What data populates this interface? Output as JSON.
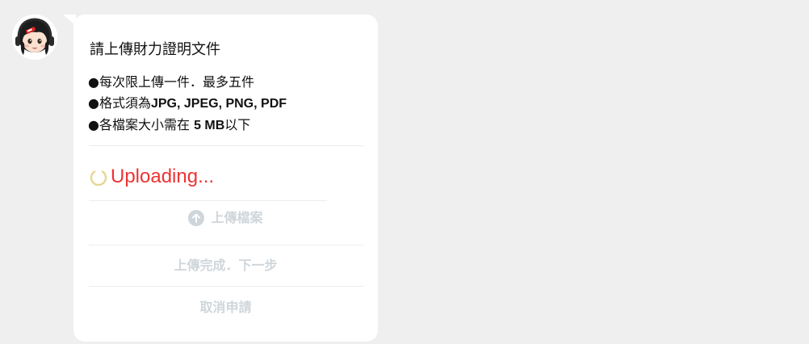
{
  "avatar": {
    "icon": "girl-avatar-icon"
  },
  "message": {
    "title": "請上傳財力證明文件",
    "rules": [
      {
        "text": "●每次限上傳一件．最多五件"
      },
      {
        "prefix": "●格式須為",
        "bold": "JPG, JPEG, PNG, PDF"
      },
      {
        "prefix": "●各檔案大小需在 ",
        "bold": "5 MB",
        "suffix": "以下"
      }
    ],
    "uploading_text": "Uploading...",
    "spinner_icon": "loading-spinner-icon",
    "upload_button_label": "上傳檔案",
    "upload_button_icon": "arrow-up-circle-icon",
    "complete_button_label": "上傳完成．下一步",
    "cancel_button_label": "取消申請"
  },
  "colors": {
    "background": "#efefef",
    "bubble": "#ffffff",
    "uploading_text": "#ee3333",
    "spinner": "#e6d692",
    "disabled_text": "#cfd6db",
    "divider": "#ececec"
  }
}
